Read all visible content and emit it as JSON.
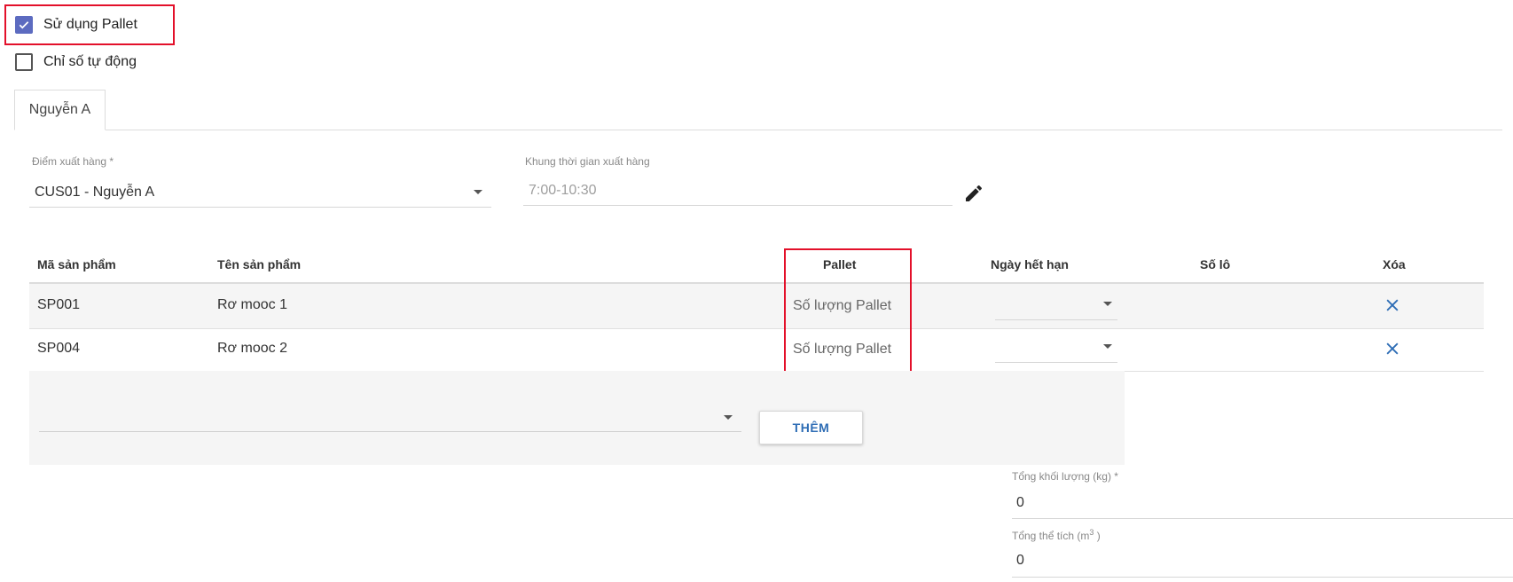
{
  "options": {
    "use_pallet": {
      "label": "Sử dụng Pallet",
      "checked": true
    },
    "auto_index": {
      "label": "Chỉ số tự động",
      "checked": false
    }
  },
  "tabs": [
    {
      "label": "Nguyễn A",
      "active": true
    }
  ],
  "form": {
    "export_point": {
      "label": "Điểm xuất hàng *",
      "value": "CUS01 - Nguyễn A"
    },
    "time_window": {
      "label": "Khung thời gian xuất hàng",
      "value": "7:00-10:30"
    }
  },
  "table": {
    "headers": {
      "code": "Mã sản phẩm",
      "name": "Tên sản phẩm",
      "pallet": "Pallet",
      "expiry": "Ngày hết hạn",
      "lot": "Số lô",
      "delete": "Xóa"
    },
    "rows": [
      {
        "code": "SP001",
        "name": "Rơ mooc 1",
        "pallet_placeholder": "Số lượng Pallet"
      },
      {
        "code": "SP004",
        "name": "Rơ mooc 2",
        "pallet_placeholder": "Số lượng Pallet"
      }
    ]
  },
  "add_row": {
    "button_label": "THÊM"
  },
  "totals": {
    "weight": {
      "label": "Tổng khối lượng (kg) *",
      "value": "0"
    },
    "volume": {
      "label": "Tổng thể tích (m",
      "unit_sup": "3",
      "label_end": " )",
      "value": "0"
    }
  },
  "colors": {
    "accent": "#5c6bc0",
    "highlight": "#e3102a",
    "link": "#2e6db5"
  }
}
